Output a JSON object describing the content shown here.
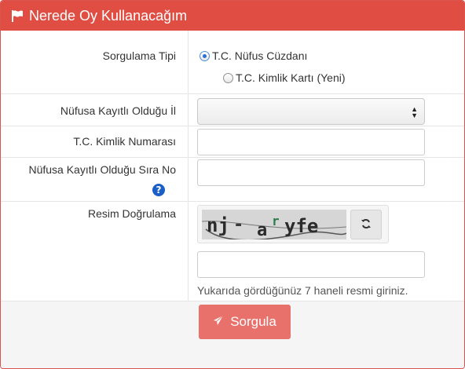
{
  "header": {
    "title": "Nerede Oy Kullanacağım",
    "icon": "flag-icon",
    "bg_color": "#e04e43"
  },
  "form": {
    "query_type_label": "Sorgulama Tipi",
    "query_options": [
      {
        "label": "T.C. Nüfus Cüzdanı",
        "checked": true
      },
      {
        "label": "T.C. Kimlik Kartı (Yeni)",
        "checked": false
      }
    ],
    "province_label": "Nüfusa Kayıtlı Olduğu İl",
    "province_value": "",
    "tc_label": "T.C. Kimlik Numarası",
    "tc_value": "",
    "seq_label": "Nüfusa Kayıtlı Olduğu Sıra No",
    "seq_value": "",
    "help_icon": "question-icon",
    "captcha_label": "Resim Doğrulama",
    "captcha_text": "nj-aryfe",
    "refresh_icon": "refresh-icon",
    "captcha_value": "",
    "captcha_hint": "Yukarıda gördüğünüz 7 haneli resmi giriniz."
  },
  "submit": {
    "label": "Sorgula",
    "icon": "send-icon",
    "color": "#e9716b"
  }
}
